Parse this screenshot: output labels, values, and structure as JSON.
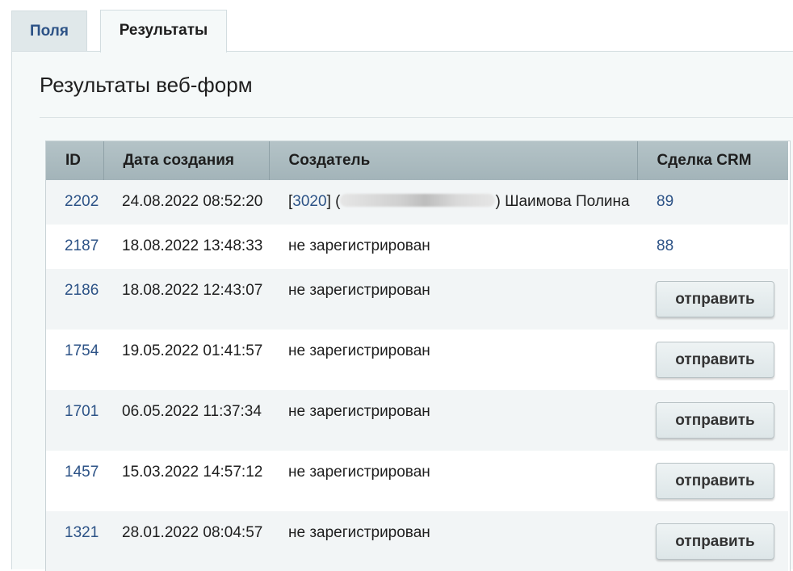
{
  "tabs": [
    {
      "label": "Поля",
      "active": false
    },
    {
      "label": "Результаты",
      "active": true
    }
  ],
  "page_title": "Результаты веб-форм",
  "table": {
    "columns": [
      "ID",
      "Дата создания",
      "Создатель",
      "Сделка CRM"
    ],
    "rows": [
      {
        "id": "2202",
        "date": "24.08.2022 08:52:20",
        "creator_user_id": "3020",
        "creator_name": "Шаимова Полина",
        "crm": "89"
      },
      {
        "id": "2187",
        "date": "18.08.2022 13:48:33",
        "creator_text": "не зарегистрирован",
        "crm": "88"
      },
      {
        "id": "2186",
        "date": "18.08.2022 12:43:07",
        "creator_text": "не зарегистрирован",
        "crm_button": "отправить"
      },
      {
        "id": "1754",
        "date": "19.05.2022 01:41:57",
        "creator_text": "не зарегистрирован",
        "crm_button": "отправить"
      },
      {
        "id": "1701",
        "date": "06.05.2022 11:37:34",
        "creator_text": "не зарегистрирован",
        "crm_button": "отправить"
      },
      {
        "id": "1457",
        "date": "15.03.2022 14:57:12",
        "creator_text": "не зарегистрирован",
        "crm_button": "отправить"
      },
      {
        "id": "1321",
        "date": "28.01.2022 08:04:57",
        "creator_text": "не зарегистрирован",
        "crm_button": "отправить"
      }
    ]
  },
  "colors": {
    "link": "#2c5286",
    "header_bg": "#a9b9bd",
    "panel_bg": "#f5f9f9"
  }
}
